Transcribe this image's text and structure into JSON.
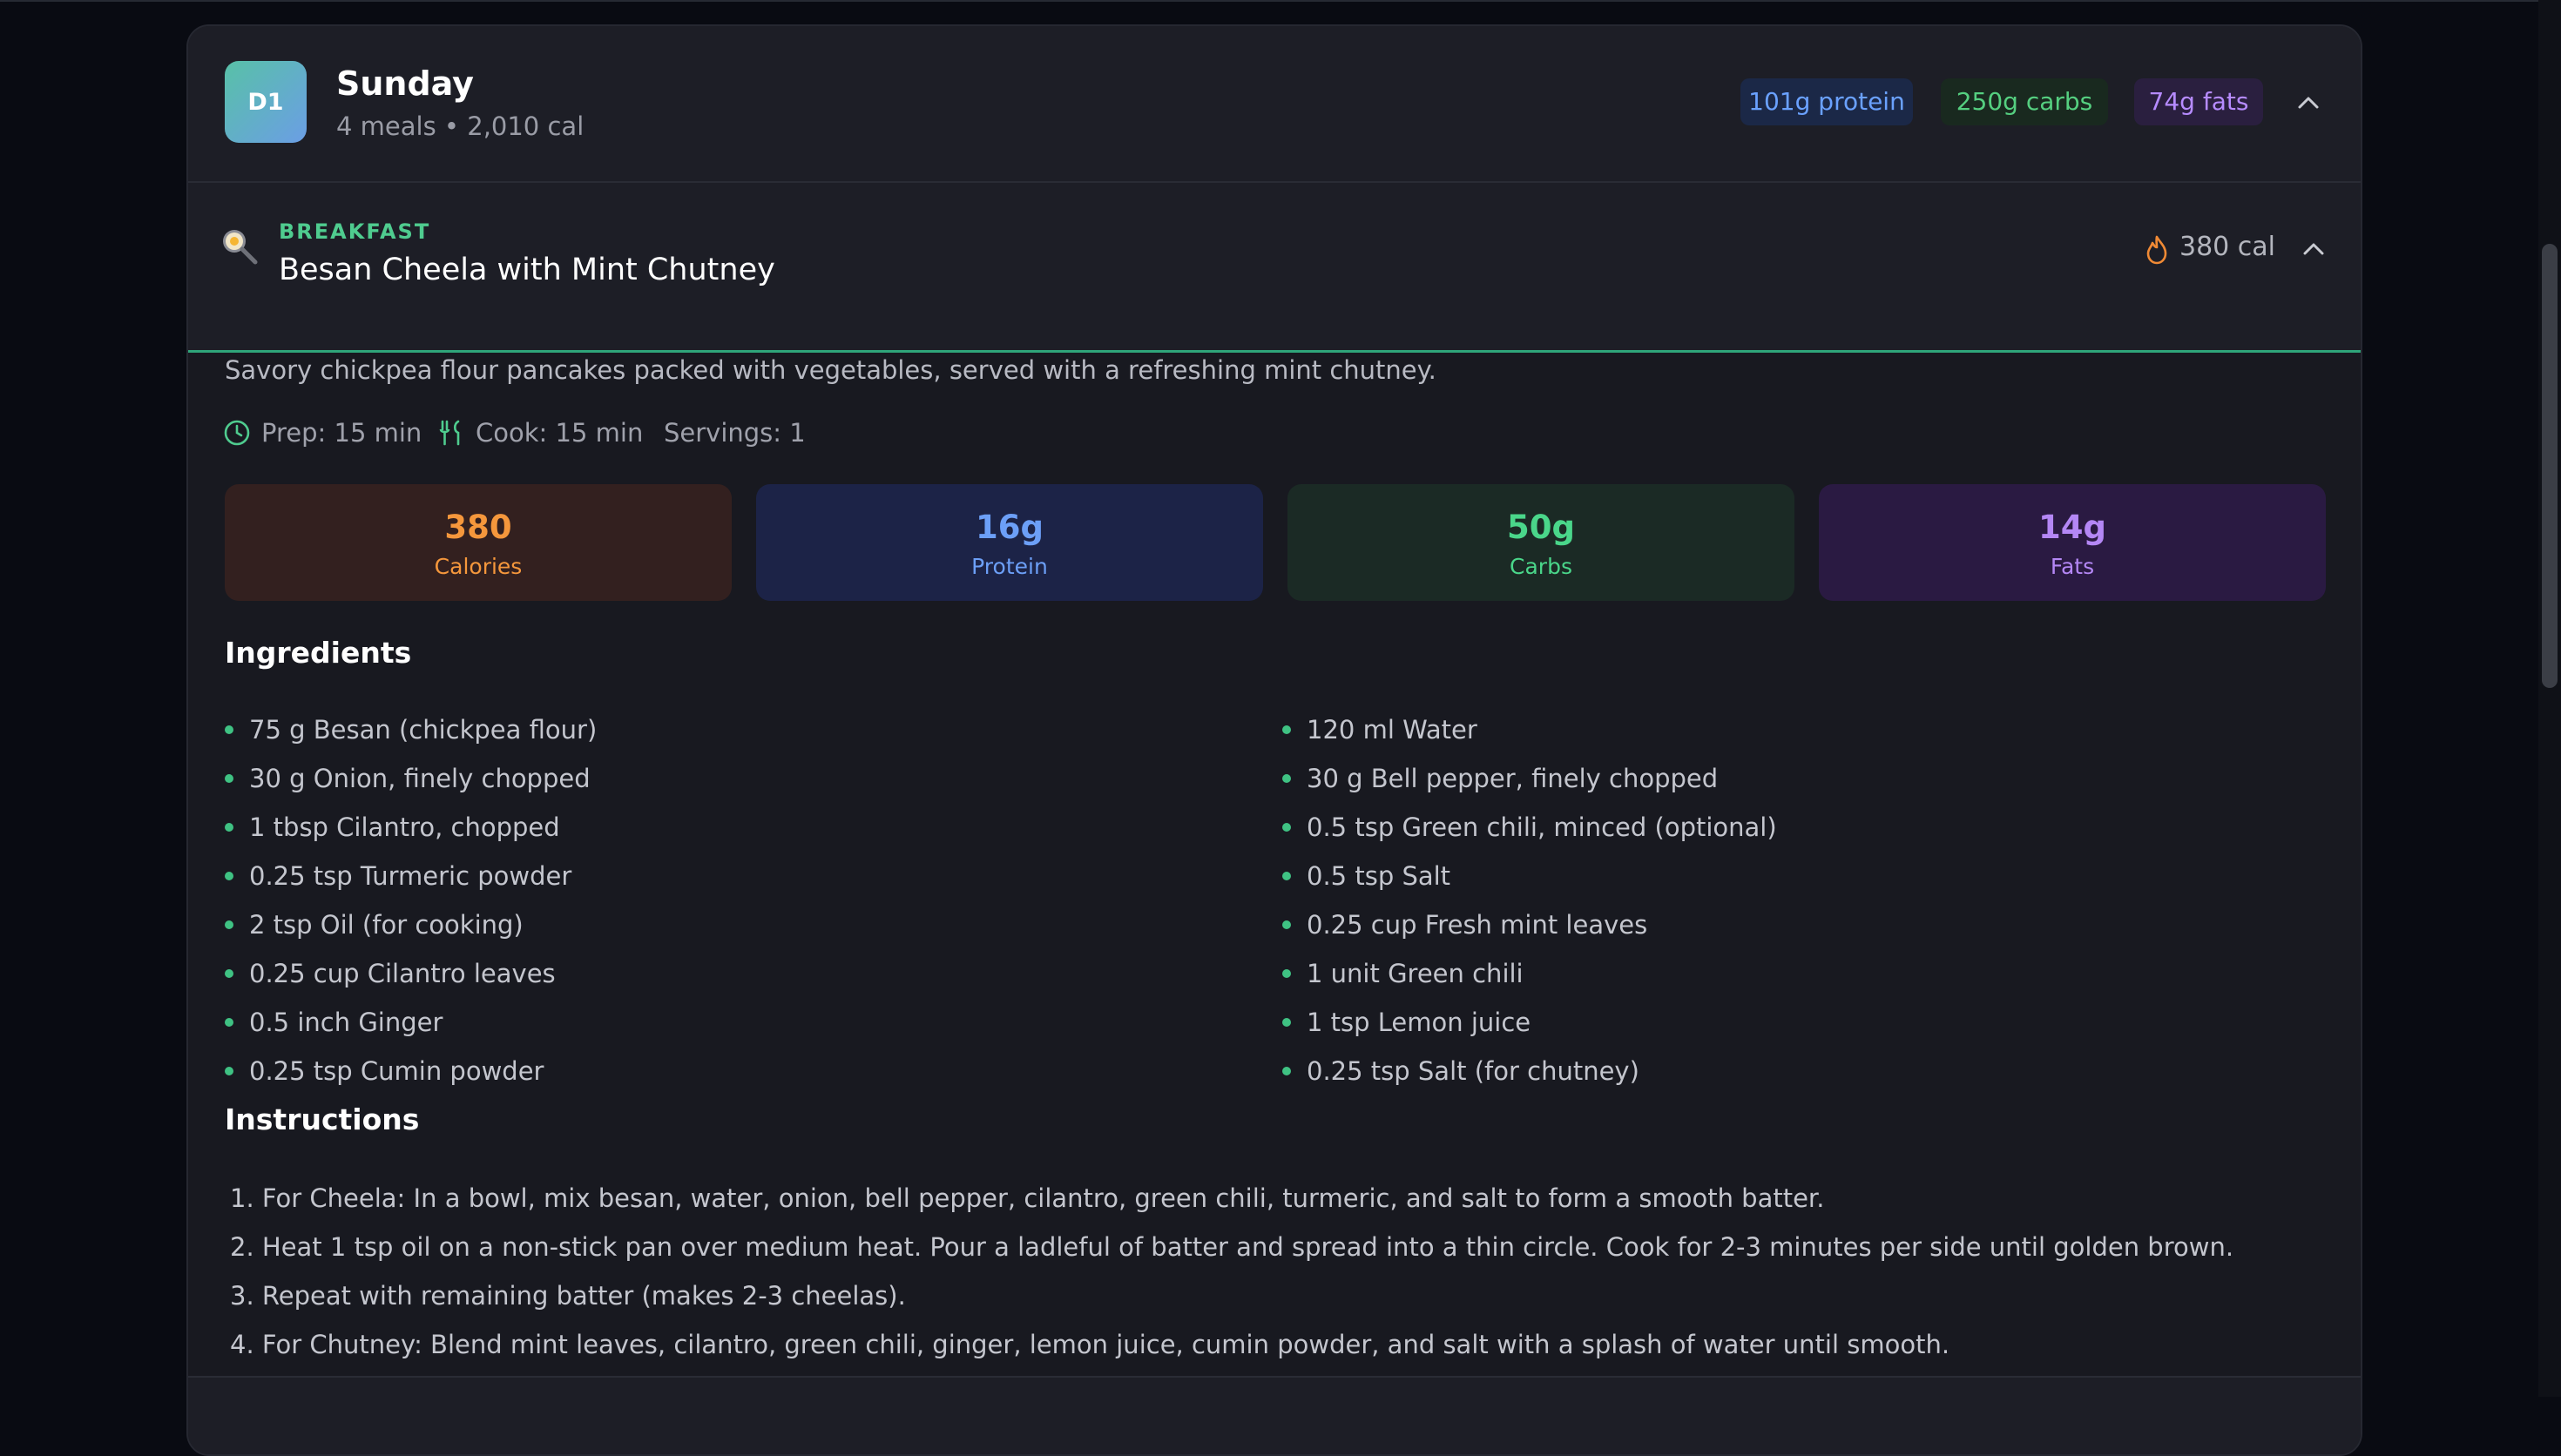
{
  "day": {
    "badge": "D1",
    "title": "Sunday",
    "subtitle": "4 meals • 2,010 cal",
    "macros": {
      "protein": "101g protein",
      "carbs": "250g carbs",
      "fats": "74g fats"
    },
    "collapse_icon": "chevron-up-icon"
  },
  "meal": {
    "type": "BREAKFAST",
    "name": "Besan Cheela with Mint Chutney",
    "icon": "cooking-pan-icon",
    "calories": "380 cal",
    "description": "Savory chickpea flour pancakes packed with vegetables, served with a refreshing mint chutney.",
    "prep": "Prep: 15 min",
    "cook": "Cook: 15 min",
    "servings": "Servings: 1",
    "stats": [
      {
        "value": "380",
        "label": "Calories"
      },
      {
        "value": "16g",
        "label": "Protein"
      },
      {
        "value": "50g",
        "label": "Carbs"
      },
      {
        "value": "14g",
        "label": "Fats"
      }
    ],
    "ingredients_title": "Ingredients",
    "ingredients_left": [
      "75 g Besan (chickpea flour)",
      "30 g Onion, finely chopped",
      "1 tbsp Cilantro, chopped",
      "0.25 tsp Turmeric powder",
      "2 tsp Oil (for cooking)",
      "0.25 cup Cilantro leaves",
      "0.5 inch Ginger",
      "0.25 tsp Cumin powder"
    ],
    "ingredients_right": [
      "120 ml Water",
      "30 g Bell pepper, finely chopped",
      "0.5 tsp Green chili, minced (optional)",
      "0.5 tsp Salt",
      "0.25 cup Fresh mint leaves",
      "1 unit Green chili",
      "1 tsp Lemon juice",
      "0.25 tsp Salt (for chutney)"
    ],
    "instructions_title": "Instructions",
    "instructions": [
      "1. For Cheela: In a bowl, mix besan, water, onion, bell pepper, cilantro, green chili, turmeric, and salt to form a smooth batter.",
      "2. Heat 1 tsp oil on a non-stick pan over medium heat. Pour a ladleful of batter and spread into a thin circle. Cook for 2-3 minutes per side until golden brown.",
      "3. Repeat with remaining batter (makes 2-3 cheelas).",
      "4. For Chutney: Blend mint leaves, cilantro, green chili, ginger, lemon juice, cumin powder, and salt with a splash of water until smooth."
    ]
  },
  "colors": {
    "accent_green": "#4fcc8f",
    "protein": "#6aa1ff",
    "carbs": "#55cf80",
    "fats": "#b68bff",
    "calories": "#f5973c"
  }
}
